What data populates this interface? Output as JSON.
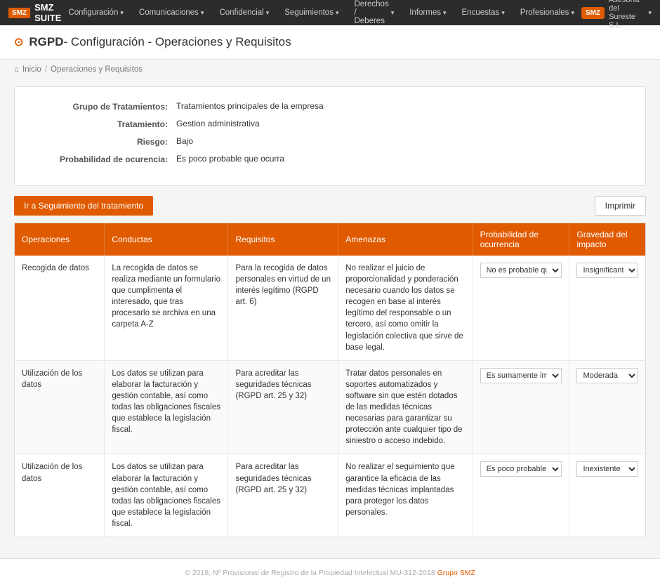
{
  "app": {
    "logo": "SMZ SUITE",
    "logo_sub": "SMZ"
  },
  "topnav": {
    "items": [
      {
        "label": "Configuración",
        "has_arrow": true
      },
      {
        "label": "Comunicaciones",
        "has_arrow": true
      },
      {
        "label": "Confidencial",
        "has_arrow": true
      },
      {
        "label": "Seguimientos",
        "has_arrow": true
      },
      {
        "label": "Derechos / Deberes",
        "has_arrow": true
      },
      {
        "label": "Informes",
        "has_arrow": true
      },
      {
        "label": "Encuestas",
        "has_arrow": true
      },
      {
        "label": "Profesionales",
        "has_arrow": true
      }
    ],
    "brand": "Asesoría del Sureste S.L.",
    "brand_arrow": true
  },
  "page_header": {
    "icon": "⊙",
    "prefix": "RGPD",
    "title": "- Configuración - Operaciones y Requisitos"
  },
  "breadcrumb": {
    "home_icon": "⌂",
    "home_label": "Inicio",
    "separator": "/",
    "current": "Operaciones y Requisitos"
  },
  "info_card": {
    "fields": [
      {
        "label": "Grupo de Tratamientos:",
        "value": "Tratamientos principales de la empresa"
      },
      {
        "label": "Tratamiento:",
        "value": "Gestion administrativa"
      },
      {
        "label": "Riesgo:",
        "value": "Bajo"
      },
      {
        "label": "Probabilidad de ocurencia:",
        "value": "Es poco probable que ocurra"
      }
    ]
  },
  "action_bar": {
    "btn_tracking": "Ir a Seguimiento del tratamiento",
    "btn_print": "Imprimir"
  },
  "table": {
    "columns": [
      "Operaciones",
      "Conductas",
      "Requisitos",
      "Amenazas",
      "Probabilidad de ocurrencia",
      "Gravedad del impacto"
    ],
    "rows": [
      {
        "operacion": "Recogida de datos",
        "conducta": "La recogida de datos se realiza mediante un formulario que cumplimenta el interesado, que tras procesarlo se archiva en una carpeta A-Z",
        "requisito": "Para la recogida de datos personales en virtud de un interés legítimo (RGPD art. 6)",
        "amenaza": "No realizar el juicio de proporcionalidad y ponderación necesario cuando los datos se recogen en base al interés legítimo del responsable o un tercero, así como omitir la legislación colectiva que sirve de base legal.",
        "probabilidad": "No es probable que ocurra",
        "gravedad": "Insignificante"
      },
      {
        "operacion": "Utilización de los datos",
        "conducta": "Los datos se utilizan para elaborar la facturación y gestión contable, así como todas las obligaciones fiscales que establece la legislación fiscal.",
        "requisito": "Para acreditar las seguridades técnicas (RGPD art. 25 y 32)",
        "amenaza": "Tratar datos personales en soportes automatizados y software sin que estén dotados de las medidas técnicas necesarias para garantizar su protección ante cualquier tipo de siniestro o acceso indebido.",
        "probabilidad": "Es sumamente improbable que ocurra",
        "gravedad": "Moderada"
      },
      {
        "operacion": "Utilización de los datos",
        "conducta": "Los datos se utilizan para elaborar la facturación y gestión contable, así como todas las obligaciones fiscales que establece la legislación fiscal.",
        "requisito": "Para acreditar las seguridades técnicas (RGPD art. 25 y 32)",
        "amenaza": "No realizar el seguimiento que garantice la eficacia de las medidas técnicas implantadas para proteger los datos personales.",
        "probabilidad": "Es poco probable que ocurra",
        "gravedad": "Inexistente"
      }
    ]
  },
  "footer": {
    "text": "© 2018, Nº Provisional de Registro de la Propiedad Intelectual MU-312-2018 ",
    "link_text": "Grupo SMZ",
    "link_url": "#"
  }
}
